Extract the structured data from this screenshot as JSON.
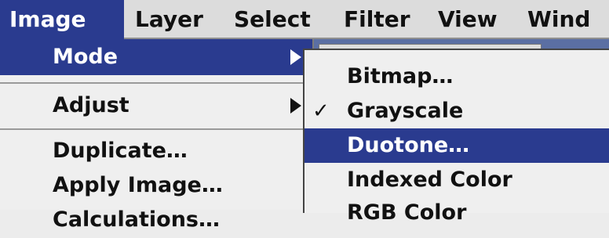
{
  "menubar": {
    "items": [
      "Image",
      "Layer",
      "Select",
      "Filter",
      "View",
      "Wind"
    ]
  },
  "image_menu": {
    "items": [
      {
        "label": "Mode",
        "has_submenu": true,
        "highlighted": true
      },
      {
        "label": "Adjust",
        "has_submenu": true,
        "highlighted": false
      },
      {
        "label": "Duplicate…",
        "has_submenu": false,
        "highlighted": false
      },
      {
        "label": "Apply Image…",
        "has_submenu": false,
        "highlighted": false
      },
      {
        "label": "Calculations…",
        "has_submenu": false,
        "highlighted": false
      }
    ]
  },
  "mode_submenu": {
    "items": [
      {
        "label": "Bitmap…",
        "checked": false,
        "highlighted": false
      },
      {
        "label": "Grayscale",
        "checked": true,
        "highlighted": false
      },
      {
        "label": "Duotone…",
        "checked": false,
        "highlighted": true
      },
      {
        "label": "Indexed Color",
        "checked": false,
        "highlighted": false
      },
      {
        "label": "RGB Color",
        "checked": false,
        "highlighted": false
      }
    ],
    "checkmark_glyph": "✓"
  },
  "colors": {
    "highlight": "#2a3b8f",
    "menu_background": "#efefef",
    "menubar_background": "#dcdcdc"
  }
}
